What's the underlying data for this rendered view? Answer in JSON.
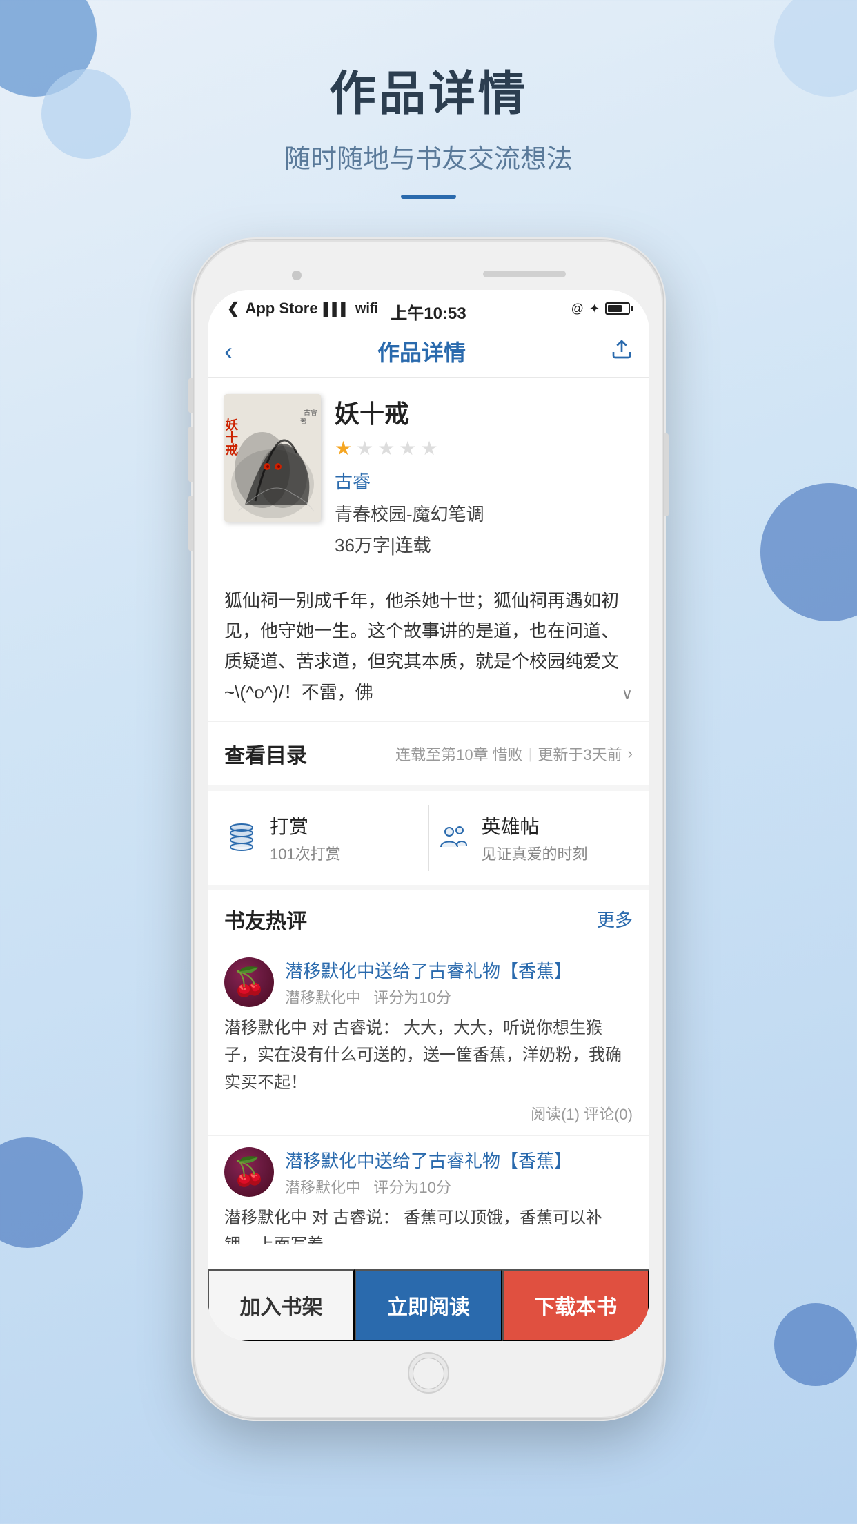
{
  "page": {
    "bg_circles": [
      1,
      2,
      3,
      4,
      5,
      6
    ]
  },
  "header": {
    "main_title": "作品详情",
    "subtitle": "随时随地与书友交流想法"
  },
  "status_bar": {
    "carrier": "App Store",
    "time": "上午10:53",
    "signal_bars": [
      3,
      5,
      7,
      9,
      11
    ],
    "bluetooth": "✦",
    "lock": "@"
  },
  "nav": {
    "title": "作品详情",
    "back_label": "‹",
    "share_label": "⬆"
  },
  "book": {
    "title": "妖十戒",
    "rating": 1,
    "total_stars": 5,
    "author": "古睿",
    "genre": "青春校园-魔幻笔调",
    "word_count": "36万字|连载",
    "description": "狐仙祠一别成千年，他杀她十世；狐仙祠再遇如初见，他守她一生。这个故事讲的是道，也在问道、质疑道、苦求道，但究其本质，就是个校园纯爱文~\\(^o^)/！不雷，佛"
  },
  "chapter": {
    "label": "查看目录",
    "current_chapter": "连载至第10章 惜败",
    "update_time": "更新于3天前"
  },
  "actions": {
    "tip": {
      "main": "打赏",
      "sub": "101次打赏"
    },
    "hero_post": {
      "main": "英雄帖",
      "sub": "见证真爱的时刻"
    }
  },
  "reviews": {
    "section_title": "书友热评",
    "more_label": "更多",
    "items": [
      {
        "title": "潜移默化中送给了古睿礼物【香蕉】",
        "user": "潜移默化中",
        "score": "评分为10分",
        "content": "潜移默化中 对 古睿说：  大大，大大，听说你想生猴子，实在没有什么可送的，送一筐香蕉，洋奶粉，我确实买不起！",
        "reads": "阅读(1)",
        "comments": "评论(0)"
      },
      {
        "title": "潜移默化中送给了古睿礼物【香蕉】",
        "user": "潜移默化中",
        "score": "评分为10分",
        "content": "潜移默化中 对 古睿说： 香蕉可以顶饿，香蕉可以补钾，上面写着…",
        "reads": "",
        "comments": ""
      }
    ]
  },
  "bottom_bar": {
    "add_shelf": "加入书架",
    "read_now": "立即阅读",
    "download": "下载本书"
  }
}
